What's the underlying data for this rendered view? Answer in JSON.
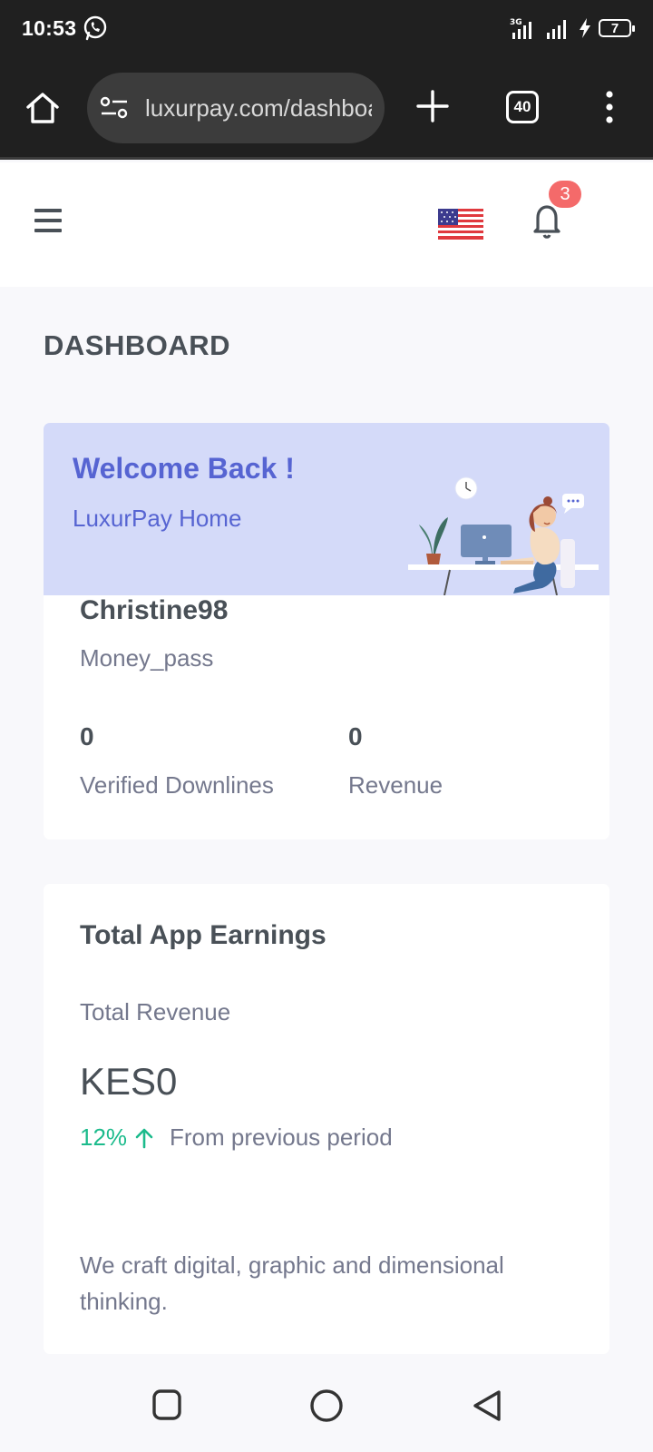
{
  "status_bar": {
    "time": "10:53",
    "network": "3G",
    "battery": "7"
  },
  "browser": {
    "url": "luxurpay.com/dashboard",
    "tab_count": "40"
  },
  "header": {
    "flag": "us-flag-icon",
    "notification_count": "3"
  },
  "page": {
    "title": "DASHBOARD"
  },
  "welcome": {
    "title": "Welcome Back !",
    "subtitle": "LuxurPay Home",
    "username": "Christine98",
    "role": "Money_pass",
    "stats": [
      {
        "value": "0",
        "label": "Verified Downlines"
      },
      {
        "value": "0",
        "label": "Revenue"
      }
    ]
  },
  "earnings": {
    "title": "Total App Earnings",
    "label": "Total Revenue",
    "value": "KES0",
    "change": "12%",
    "change_note": "From previous period",
    "tagline": "We craft digital, graphic and dimensional thinking."
  },
  "colors": {
    "primary": "#5664d2",
    "banner": "#d4daf9",
    "success": "#1cbb8c",
    "badge": "#f46a6a",
    "text_dark": "#495057",
    "text_muted": "#74788d"
  }
}
